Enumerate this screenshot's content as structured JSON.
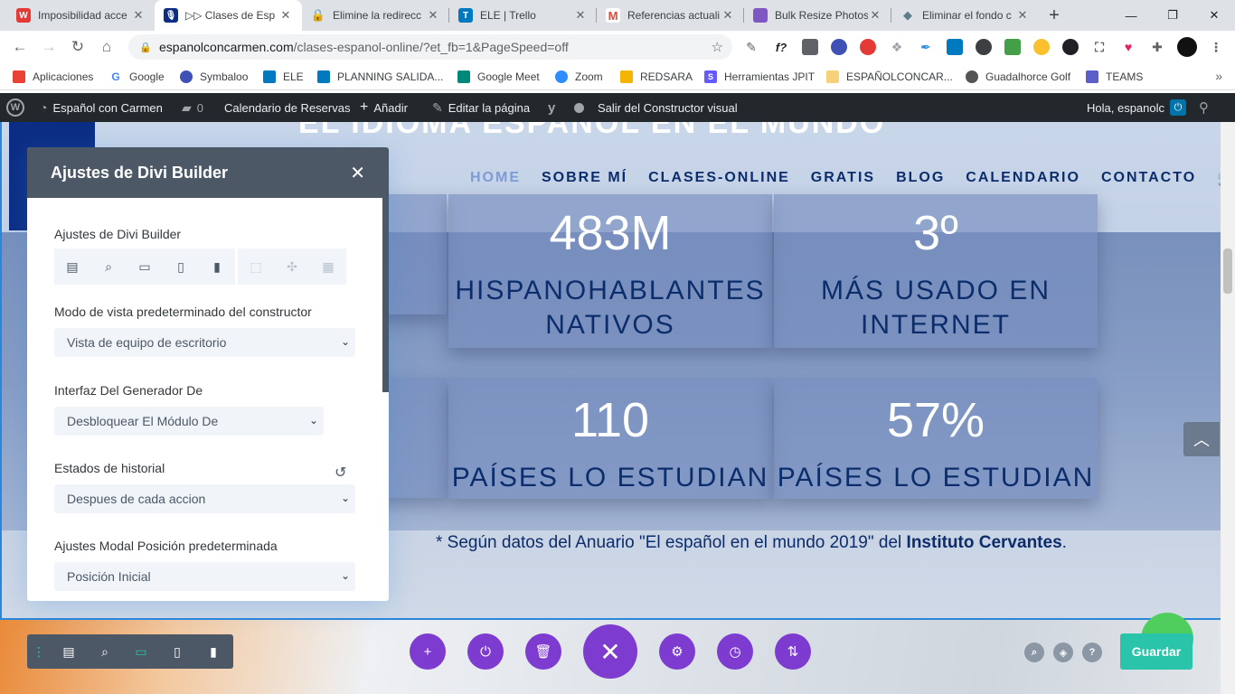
{
  "browser": {
    "tabs": [
      {
        "title": "Imposibilidad acce",
        "favicon": "weebly-icon",
        "color": "#e53935"
      },
      {
        "title": "▷▷ Clases de Esp",
        "favicon": "microphone-icon",
        "color": "#0c2d83"
      },
      {
        "title": "Elimine la redirecc",
        "favicon": "lock-icon",
        "color": "#f5b400"
      },
      {
        "title": "ELE | Trello",
        "favicon": "trello-icon",
        "color": "#0079bf"
      },
      {
        "title": "Referencias actuali",
        "favicon": "gmail-icon",
        "color": "#ea4335"
      },
      {
        "title": "Bulk Resize Photos",
        "favicon": "photos-icon",
        "color": "#7e57c2"
      },
      {
        "title": "Eliminar el fondo c",
        "favicon": "diamond-icon",
        "color": "#607d8b"
      }
    ],
    "new_tab": "+",
    "url_domain": "espanolconcarmen.com",
    "url_path": "/clases-espanol-online/?et_fb=1&PageSpeed=off"
  },
  "bookmarks": [
    {
      "label": "Aplicaciones",
      "icon": "apps-grid-icon",
      "color": "#ea4335"
    },
    {
      "label": "Google",
      "icon": "google-icon",
      "color": "#4285f4"
    },
    {
      "label": "Symbaloo",
      "icon": "symbaloo-icon",
      "color": "#3f51b5"
    },
    {
      "label": "ELE",
      "icon": "trello-icon",
      "color": "#0079bf"
    },
    {
      "label": "PLANNING SALIDA...",
      "icon": "trello-icon",
      "color": "#0079bf"
    },
    {
      "label": "Google Meet",
      "icon": "meet-icon",
      "color": "#00897b"
    },
    {
      "label": "Zoom",
      "icon": "zoom-icon",
      "color": "#2d8cff"
    },
    {
      "label": "REDSARA",
      "icon": "folder-icon",
      "color": "#f5b400"
    },
    {
      "label": "Herramientas JPIT",
      "icon": "stripe-icon",
      "color": "#635bff"
    },
    {
      "label": "ESPAÑOLCONCAR...",
      "icon": "folder-icon",
      "color": "#f5d27a"
    },
    {
      "label": "Guadalhorce Golf",
      "icon": "golf-icon",
      "color": "#555555"
    },
    {
      "label": "TEAMS",
      "icon": "teams-icon",
      "color": "#5b5fc7"
    }
  ],
  "wp_admin_bar": {
    "site_name": "Español con Carmen",
    "comments_count": "0",
    "calendar": "Calendario de Reservas",
    "add_new": "Añadir",
    "edit_page": "Editar la página",
    "exit_builder": "Salir del Constructor visual",
    "greeting": "Hola, espanolc"
  },
  "site": {
    "hero_title": "EL IDIOMA ESPAÑOL EN EL MUNDO",
    "nav": [
      "HOME",
      "SOBRE MÍ",
      "CLASES-ONLINE",
      "GRATIS",
      "BLOG",
      "CALENDARIO",
      "CONTACTO"
    ],
    "active_nav": "HOME",
    "stats": [
      {
        "number": "483M",
        "label_line1": "HISPANOHABLANTES",
        "label_line2": "NATIVOS"
      },
      {
        "number": "3º",
        "label_line1": "MÁS USADO EN",
        "label_line2": "INTERNET"
      },
      {
        "number": "110",
        "label_line1": "PAÍSES LO ESTUDIAN",
        "label_line2": ""
      },
      {
        "number": "57%",
        "label_line1": "PAÍSES LO ESTUDIAN",
        "label_line2": ""
      }
    ],
    "source_note_prefix": "* Según datos del Anuario \"El español en el mundo 2019\" del ",
    "source_note_bold": "Instituto Cervantes",
    "source_note_suffix": "."
  },
  "divi_modal": {
    "title": "Ajustes de Divi Builder",
    "section_builder": "Ajustes de Divi Builder",
    "section_view_mode": "Modo de vista predeterminado del constructor",
    "view_mode_value": "Vista de equipo de escritorio",
    "section_interface": "Interfaz Del Generador De",
    "interface_value": "Desbloquear El Módulo De",
    "section_history": "Estados de historial",
    "history_value": "Despues de cada accion",
    "section_modal_position": "Ajustes Modal Posición predeterminada",
    "modal_position_value": "Posición Inicial"
  },
  "divi_toolbar": {
    "save_label": "Guardar"
  },
  "colors": {
    "divi_purple": "#7e3bd0",
    "divi_green": "#29c4a9",
    "divi_dark": "#4c5866",
    "site_navy": "#0c2d6b",
    "wp_bar": "#23282d"
  }
}
